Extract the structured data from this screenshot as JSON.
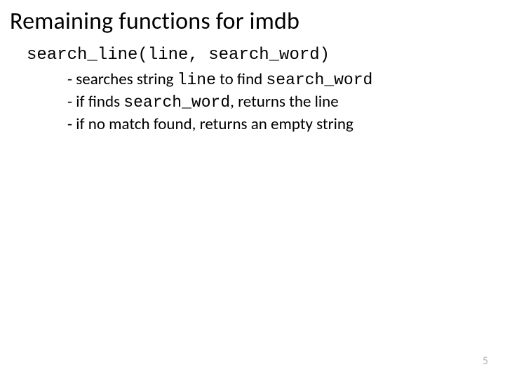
{
  "title": "Remaining functions for imdb",
  "signature": "search_line(line, search_word)",
  "bullets": [
    {
      "dash": "- ",
      "t1": "searches  string ",
      "c1": "line",
      "t2": " to find ",
      "c2": "search_word",
      "t3": ""
    },
    {
      "dash": "- ",
      "t1": "if finds ",
      "c1": "search_word",
      "t2": ", returns the line",
      "c2": "",
      "t3": ""
    },
    {
      "dash": "- ",
      "t1": "if no match found, returns an empty string",
      "c1": "",
      "t2": "",
      "c2": "",
      "t3": ""
    }
  ],
  "pagenum": "5"
}
